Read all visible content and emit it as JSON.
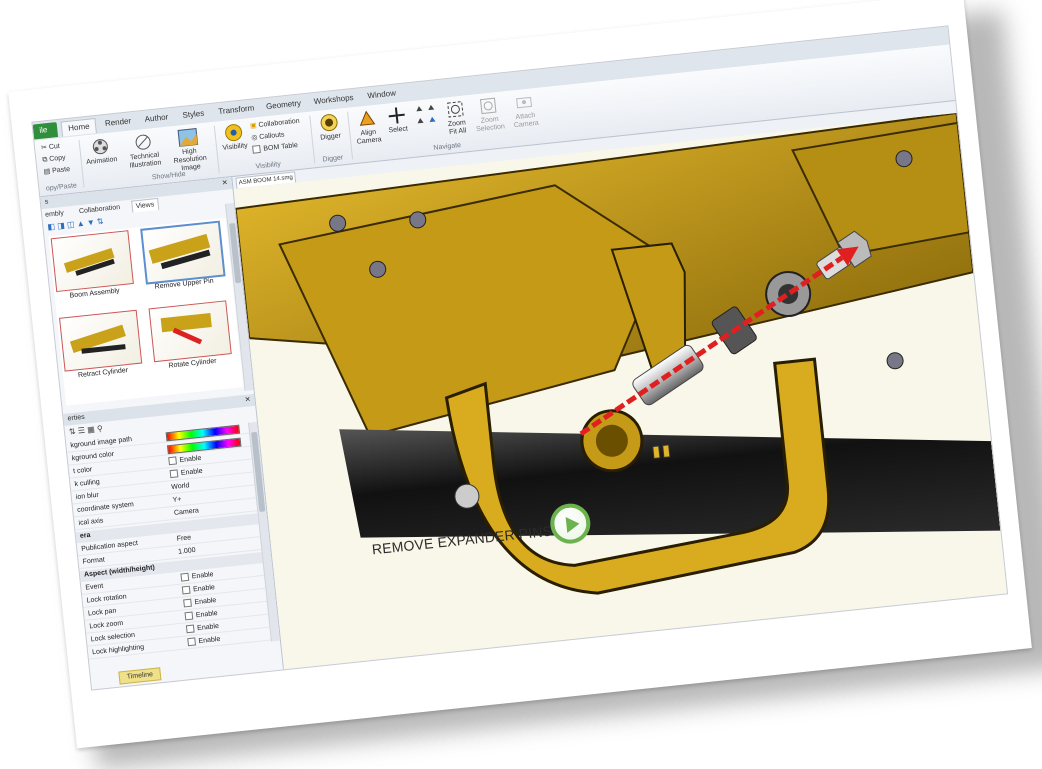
{
  "ribbon_tabs": {
    "file": "ile",
    "home": "Home",
    "render": "Render",
    "author": "Author",
    "styles": "Styles",
    "transform": "Transform",
    "geometry": "Geometry",
    "workshops": "Workshops",
    "window": "Window"
  },
  "clipboard": {
    "cut": "Cut",
    "copy": "Copy",
    "paste": "Paste",
    "group": "opy/Paste"
  },
  "showhide": {
    "animation": "Animation",
    "technical": "Technical",
    "illustration": "Illustration",
    "highres": "High Resolution",
    "image": "Image",
    "group": "Show/Hide"
  },
  "visibility": {
    "visibility": "Visibility",
    "collaboration": "Collaboration",
    "callouts": "Callouts",
    "bom_table": "BOM Table",
    "group": "Visibility"
  },
  "digger": {
    "label": "Digger",
    "group": "Digger"
  },
  "navigate": {
    "align_camera": "Align",
    "camera": "Camera",
    "select": "Select",
    "zoom_fit": "Zoom",
    "fit_all": "Fit All",
    "zoom_sel": "Zoom",
    "selection": "Selection",
    "attach": "Attach",
    "attach_cam": "Camera",
    "group": "Navigate"
  },
  "left_panel": {
    "top_head": "s",
    "subtabs": [
      "embly",
      "Collaboration",
      "Views"
    ],
    "thumbs": [
      {
        "caption": "Boom Assembly"
      },
      {
        "caption": "Remove Upper Pin"
      },
      {
        "caption": "Retract Cylinder"
      },
      {
        "caption": "Rotate Cylinder"
      }
    ]
  },
  "properties": {
    "head": "erties",
    "rows": [
      {
        "k": "kground image path",
        "v": ""
      },
      {
        "k": "kground color",
        "v": ""
      },
      {
        "k": "t color",
        "v": "Enable"
      },
      {
        "k": "k culling",
        "v": "Enable"
      },
      {
        "k": "ion blur",
        "v": "World"
      },
      {
        "k": "coordinate system",
        "v": "Y+"
      },
      {
        "k": "ical axis",
        "v": "Camera"
      },
      {
        "k": "era",
        "v": "",
        "group": true
      },
      {
        "k": "Publication aspect",
        "v": "Free"
      },
      {
        "k": "Format",
        "v": "1.000"
      },
      {
        "k": "Aspect (width/height)",
        "v": "",
        "group": true
      },
      {
        "k": "Event",
        "v": "Enable"
      },
      {
        "k": "Lock rotation",
        "v": "Enable"
      },
      {
        "k": "Lock pan",
        "v": "Enable"
      },
      {
        "k": "Lock zoom",
        "v": "Enable"
      },
      {
        "k": "Lock selection",
        "v": "Enable"
      },
      {
        "k": "Lock highlighting",
        "v": "Enable"
      }
    ],
    "timeline": "Timeline"
  },
  "document": {
    "tab": "ASM BOOM 14.smg"
  },
  "viewport": {
    "caption": "REMOVE EXPANDER PINS"
  },
  "colors": {
    "accent_green": "#6cb24f",
    "part_gold": "#c9a21a",
    "arrow_red": "#e02020"
  }
}
